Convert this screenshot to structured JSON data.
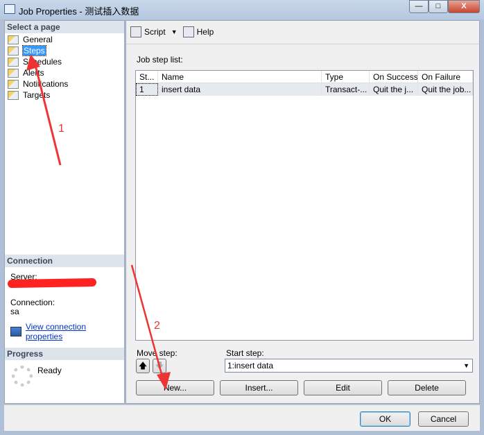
{
  "window": {
    "title": "Job Properties - 测试插入数据",
    "minimize": "—",
    "maximize": "□",
    "close": "X"
  },
  "left": {
    "select_header": "Select a page",
    "pages": [
      {
        "label": "General"
      },
      {
        "label": "Steps",
        "selected": true
      },
      {
        "label": "Schedules"
      },
      {
        "label": "Alerts"
      },
      {
        "label": "Notifications"
      },
      {
        "label": "Targets"
      }
    ],
    "connection_header": "Connection",
    "server_label": "Server:",
    "connection_label": "Connection:",
    "connection_value": "sa",
    "view_link": "View connection properties",
    "progress_header": "Progress",
    "progress_status": "Ready"
  },
  "toolbar": {
    "script": "Script",
    "help": "Help"
  },
  "main": {
    "list_label": "Job step list:",
    "columns": [
      "St...",
      "Name",
      "Type",
      "On Success",
      "On Failure"
    ],
    "rows": [
      [
        "1",
        "insert data",
        "Transact-...",
        "Quit the j...",
        "Quit the job..."
      ]
    ],
    "move_step_label": "Move step:",
    "start_step_label": "Start step:",
    "start_step_value": "1:insert data",
    "buttons": {
      "new": "New...",
      "insert": "Insert...",
      "edit": "Edit",
      "delete": "Delete"
    }
  },
  "footer": {
    "ok": "OK",
    "cancel": "Cancel"
  },
  "annotations": {
    "one": "1",
    "two": "2",
    "color": "#ee3333"
  }
}
